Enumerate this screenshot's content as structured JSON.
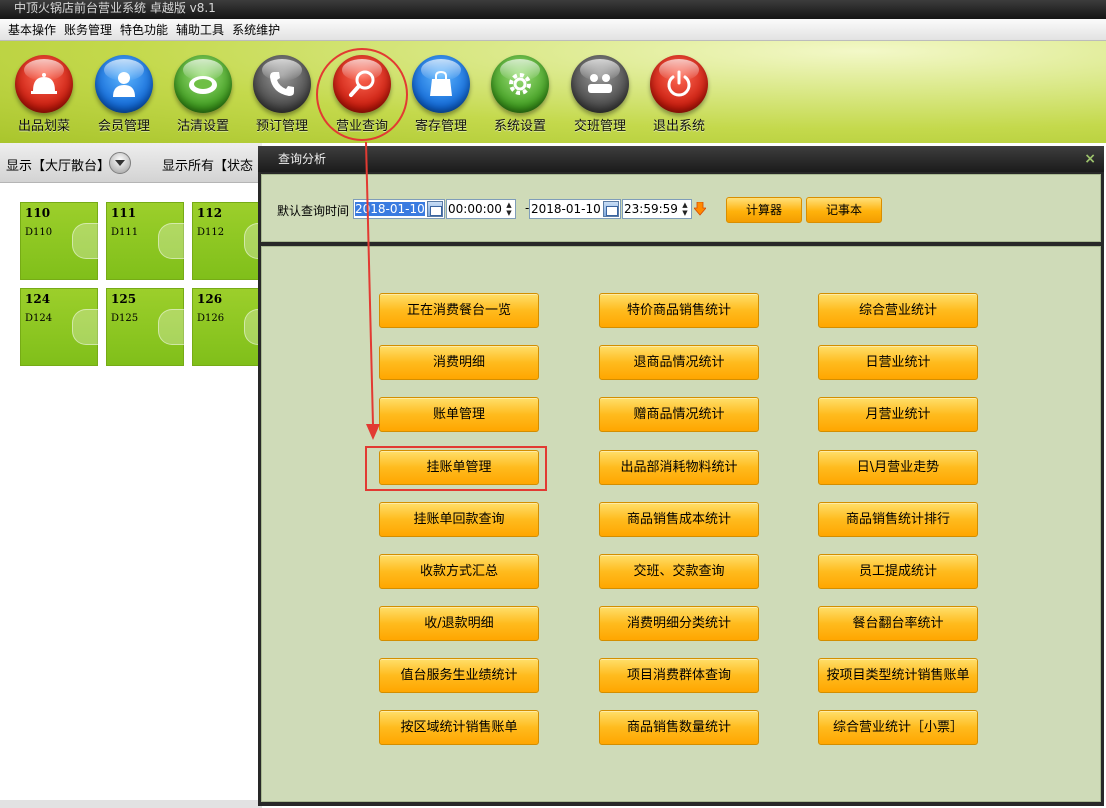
{
  "window_title": "中顶火锅店前台营业系统 卓越版 v8.1",
  "menu": [
    "基本操作",
    "账务管理",
    "特色功能",
    "辅助工具",
    "系统维护"
  ],
  "toolbar": [
    {
      "label": "出品划菜",
      "icon": "cloche-icon",
      "color": "red"
    },
    {
      "label": "会员管理",
      "icon": "member-icon",
      "color": "blue"
    },
    {
      "label": "沽清设置",
      "icon": "plate-icon",
      "color": "green"
    },
    {
      "label": "预订管理",
      "icon": "phone-icon",
      "color": "dark"
    },
    {
      "label": "营业查询",
      "icon": "magnifier-icon",
      "color": "red"
    },
    {
      "label": "寄存管理",
      "icon": "bag-icon",
      "color": "blue"
    },
    {
      "label": "系统设置",
      "icon": "gear-icon",
      "color": "green"
    },
    {
      "label": "交班管理",
      "icon": "handover-icon",
      "color": "dark"
    },
    {
      "label": "退出系统",
      "icon": "power-icon",
      "color": "red"
    }
  ],
  "left_panel": {
    "display_label": "显示【大厅散台】",
    "status_label": "显示所有【状态",
    "tables": [
      {
        "num": "110",
        "code": "D110"
      },
      {
        "num": "111",
        "code": "D111"
      },
      {
        "num": "112",
        "code": "D112"
      },
      {
        "num": "124",
        "code": "D124"
      },
      {
        "num": "125",
        "code": "D125"
      },
      {
        "num": "126",
        "code": "D126"
      }
    ]
  },
  "dialog": {
    "title": "查询分析",
    "close": "×",
    "query_label": "默认查询时间",
    "start_date": "2018-01-10",
    "start_time": "00:00:00",
    "separator": "-",
    "end_date": "2018-01-10",
    "end_time": "23:59:59",
    "calculator": "计算器",
    "notepad": "记事本",
    "columns": [
      [
        "正在消费餐台一览",
        "消费明细",
        "账单管理",
        "挂账单管理",
        "挂账单回款查询",
        "收款方式汇总",
        "收/退款明细",
        "值台服务生业绩统计",
        "按区域统计销售账单"
      ],
      [
        "特价商品销售统计",
        "退商品情况统计",
        "赠商品情况统计",
        "出品部消耗物料统计",
        "商品销售成本统计",
        "交班、交款查询",
        "消费明细分类统计",
        "项目消费群体查询",
        "商品销售数量统计"
      ],
      [
        "综合营业统计",
        "日营业统计",
        "月营业统计",
        "日\\月营业走势",
        "商品销售统计排行",
        "员工提成统计",
        "餐台翻台率统计",
        "按项目类型统计销售账单",
        "综合营业统计［小票］"
      ]
    ]
  },
  "colors": {
    "accent_red": "#e23a32",
    "button_orange": "#ffbb1e",
    "panel_green": "#cfdbb8"
  }
}
